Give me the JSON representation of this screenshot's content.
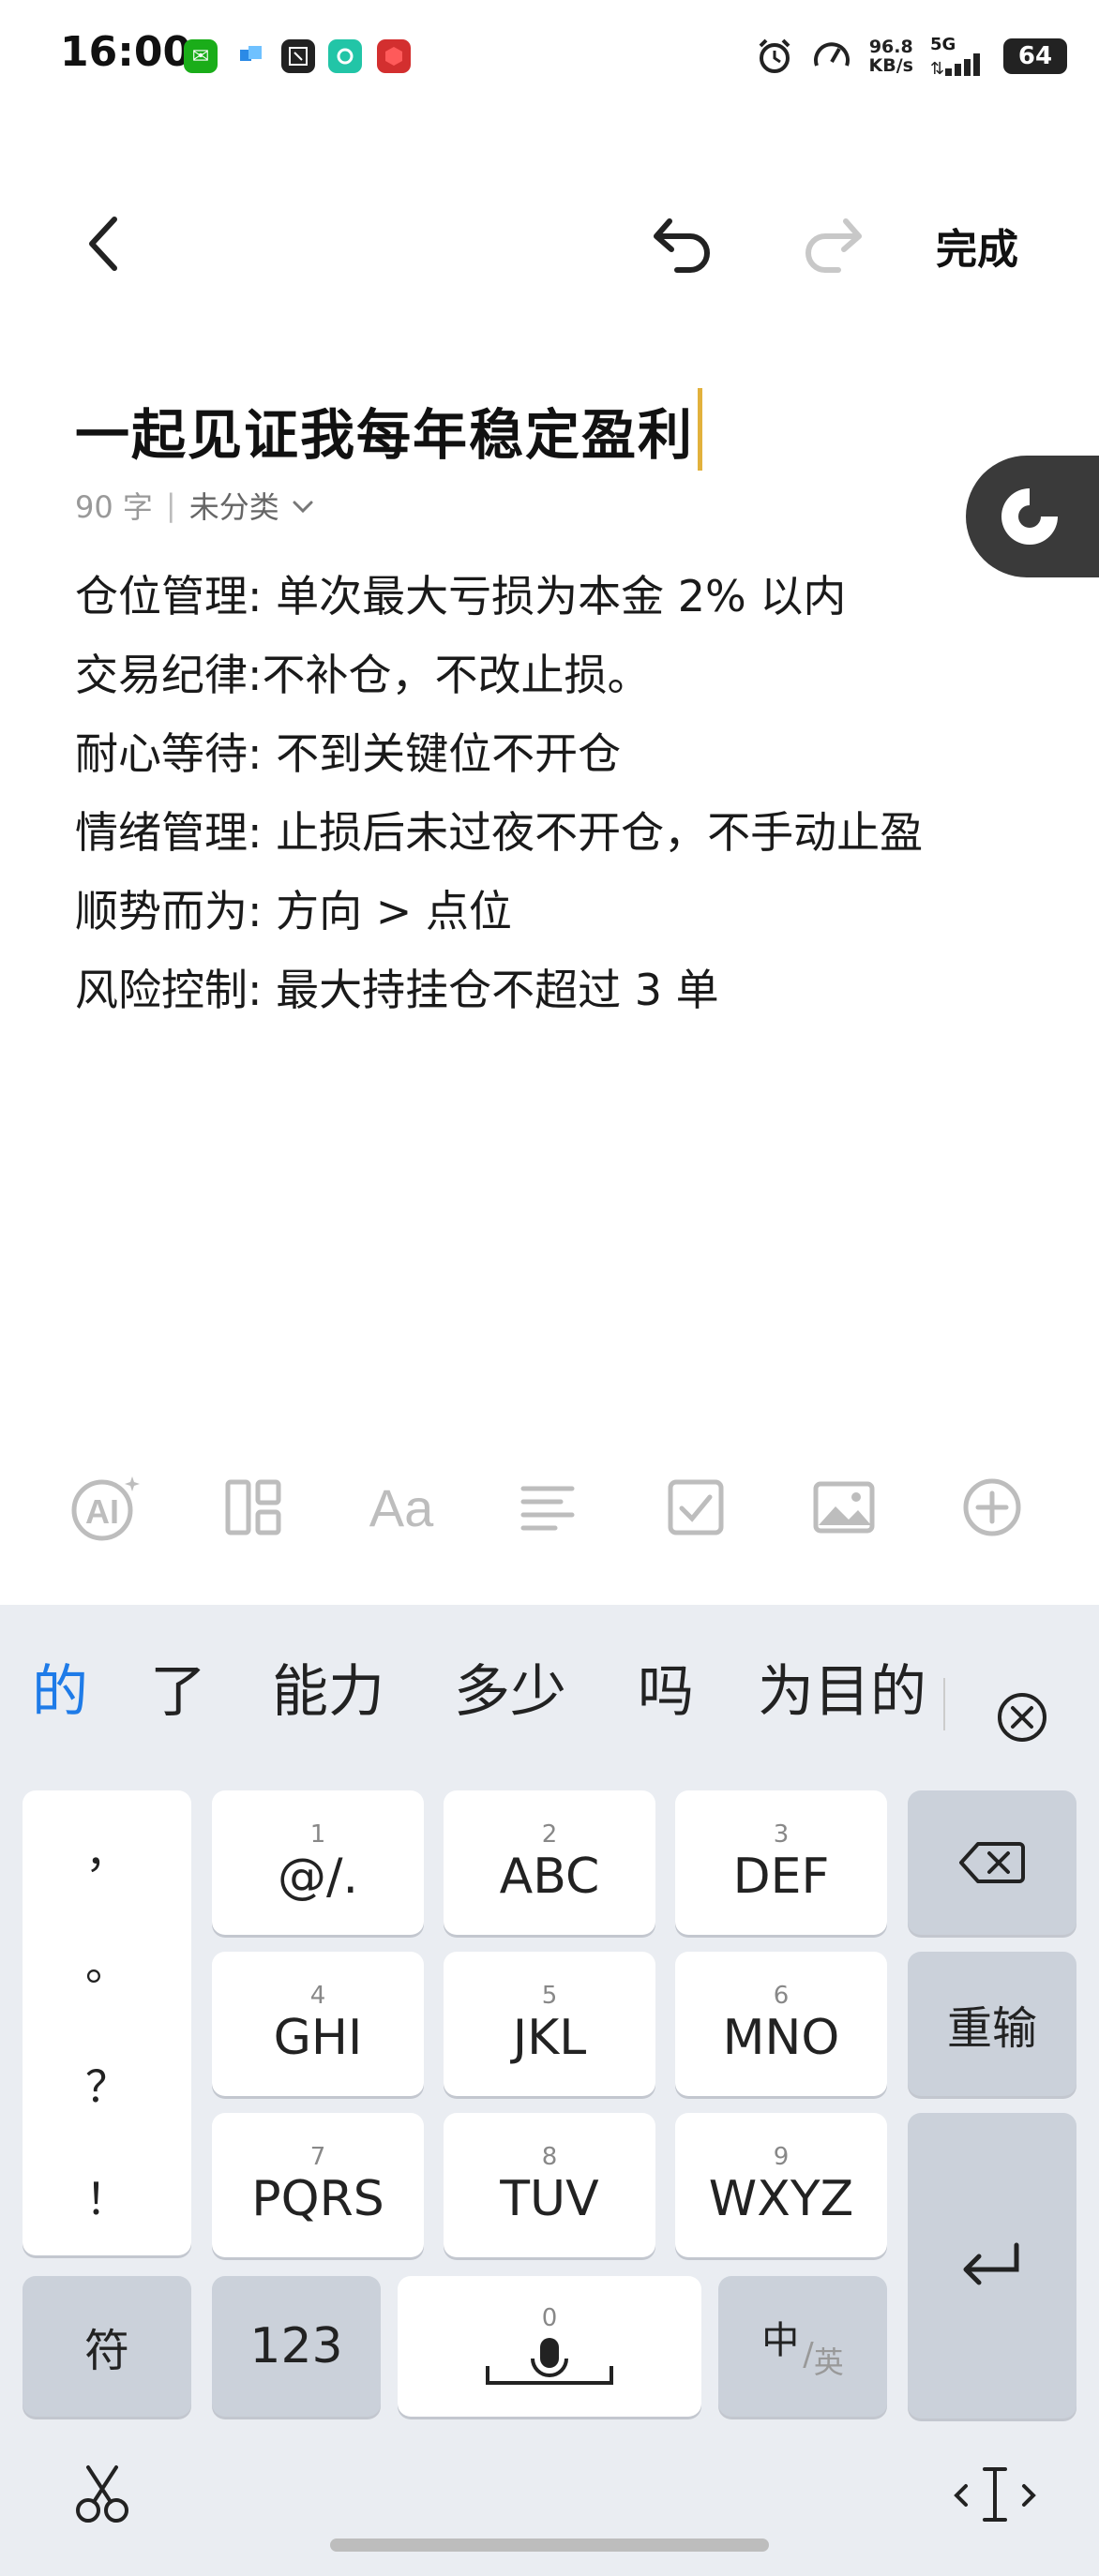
{
  "status_bar": {
    "time": "16:00",
    "net_speed_value": "96.8",
    "net_speed_unit": "KB/s",
    "signal_label": "5G",
    "battery": "64"
  },
  "header": {
    "done_label": "完成"
  },
  "note": {
    "title": "一起见证我每年稳定盈利",
    "word_count": "90 字",
    "category": "未分类",
    "body_lines": [
      "仓位管理: 单次最大亏损为本金 2% 以内",
      "交易纪律:不补仓，不改止损。",
      "耐心等待: 不到关键位不开仓",
      "情绪管理: 止损后未过夜不开仓，不手动止盈",
      "顺势而为: 方向 > 点位",
      "风险控制: 最大持挂仓不超过 3 单"
    ]
  },
  "toolbar": {
    "ai_label": "AI",
    "font_label": "Aa"
  },
  "keyboard": {
    "candidates": [
      "的",
      "了",
      "能力",
      "多少",
      "吗",
      "为目的"
    ],
    "punctuation": [
      "，",
      "。",
      "？",
      "！"
    ],
    "keys": [
      {
        "num": "1",
        "label": "@/."
      },
      {
        "num": "2",
        "label": "ABC"
      },
      {
        "num": "3",
        "label": "DEF"
      },
      {
        "num": "4",
        "label": "GHI"
      },
      {
        "num": "5",
        "label": "JKL"
      },
      {
        "num": "6",
        "label": "MNO"
      },
      {
        "num": "7",
        "label": "PQRS"
      },
      {
        "num": "8",
        "label": "TUV"
      },
      {
        "num": "9",
        "label": "WXYZ"
      }
    ],
    "reenter_label": "重输",
    "symbol_label": "符",
    "number_label": "123",
    "space_num": "0",
    "lang_cn": "中",
    "lang_en": "英"
  },
  "colors": {
    "accent_blue": "#1e7be8",
    "caret": "#e2b13c"
  }
}
